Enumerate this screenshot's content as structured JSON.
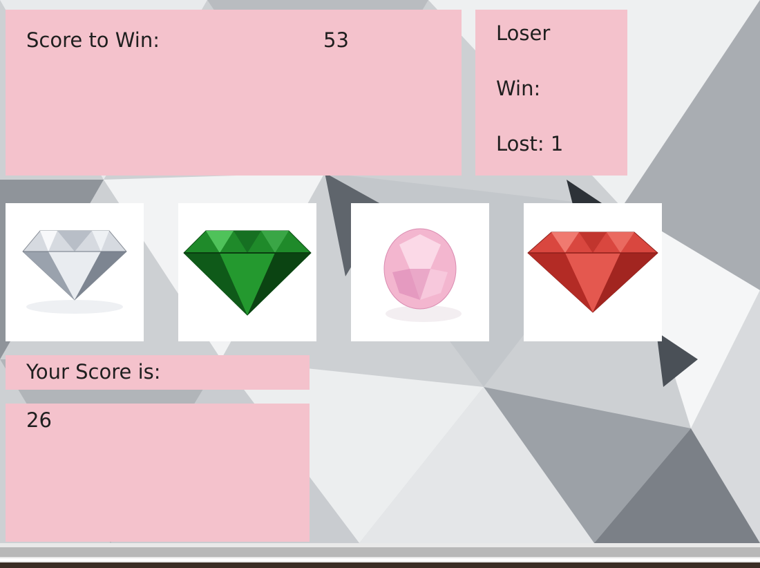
{
  "game": {
    "target_label": "Score to Win:",
    "target_value": "53",
    "status": "Loser",
    "wins_label": "Win:",
    "wins_value": "",
    "losses_label": "Lost:",
    "losses_value": "1",
    "your_score_label": "Your Score is:",
    "your_score_value": "26"
  },
  "crystals": [
    {
      "name": "clear-diamond",
      "color": "#d9dde3"
    },
    {
      "name": "green-emerald",
      "color": "#1f8a2a"
    },
    {
      "name": "pink-diamond",
      "color": "#f3b6cf"
    },
    {
      "name": "red-ruby",
      "color": "#d9473f"
    }
  ],
  "colors": {
    "panel": "#f4c2cc",
    "background": "#cfd2d4"
  }
}
